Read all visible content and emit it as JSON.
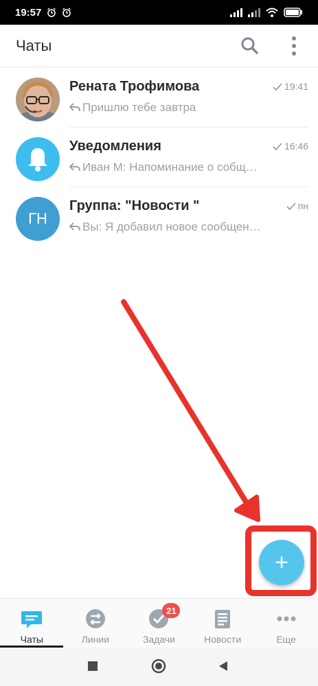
{
  "status_bar": {
    "time": "19:57",
    "icons": [
      "alarm-icon",
      "alarm-clock-icon",
      "signal-icon",
      "signal-icon",
      "wifi-icon",
      "battery-icon"
    ]
  },
  "app_bar": {
    "title": "Чаты",
    "icons": [
      "search-icon",
      "more-vert-icon"
    ]
  },
  "chats": [
    {
      "name": "Рената Трофимова",
      "time": "19:41",
      "preview": "Пришлю тебе завтра",
      "avatar": "photo",
      "read_icon": "check-icon",
      "reply_icon": "reply-icon"
    },
    {
      "name": "Уведомления",
      "time": "16:46",
      "preview": "Иван М: Напоминание о собщ…",
      "avatar": "bell-icon",
      "avatar_color": "#3dbdef",
      "read_icon": "check-icon",
      "reply_icon": "reply-icon"
    },
    {
      "name": "Группа: \"Новости \"",
      "time": "пн",
      "preview": "Вы: Я добавил новое сообщен…",
      "avatar": "initials",
      "avatar_initials": "ГН",
      "avatar_color": "#3f9fd3",
      "read_icon": "check-icon",
      "reply_icon": "reply-icon"
    }
  ],
  "fab": {
    "label": "+",
    "icon": "plus-icon",
    "color": "#55c5ec",
    "highlight_color": "#e8332c"
  },
  "bottom_nav": [
    {
      "label": "Чаты",
      "icon": "chat-icon",
      "active": true
    },
    {
      "label": "Линии",
      "icon": "lines-icon",
      "active": false
    },
    {
      "label": "Задачи",
      "icon": "tasks-check-icon",
      "active": false,
      "badge": "21"
    },
    {
      "label": "Новости",
      "icon": "news-icon",
      "active": false
    },
    {
      "label": "Еще",
      "icon": "more-horiz-icon",
      "active": false
    }
  ],
  "system_nav": [
    "recents-square-icon",
    "home-circle-icon",
    "back-triangle-icon"
  ]
}
